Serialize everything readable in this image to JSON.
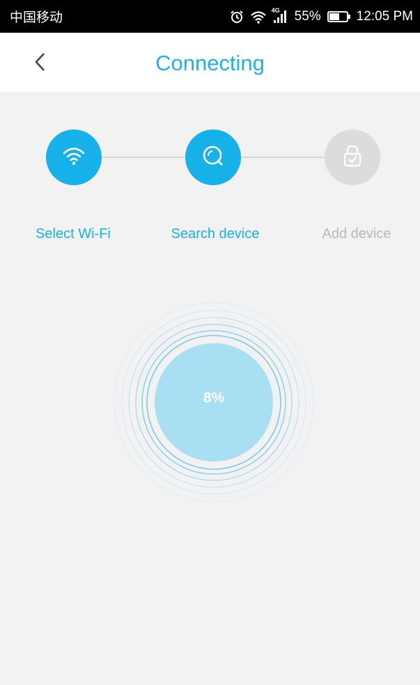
{
  "status_bar": {
    "carrier": "中国移动",
    "network": "4G",
    "battery": "55%",
    "time": "12:05 PM",
    "icons": [
      "alarm-icon",
      "wifi-icon",
      "signal-icon",
      "battery-icon"
    ]
  },
  "header": {
    "title": "Connecting",
    "back_icon": "chevron-left-icon"
  },
  "steps": [
    {
      "label": "Select Wi-Fi",
      "icon": "wifi-icon",
      "state": "complete"
    },
    {
      "label": "Search device",
      "icon": "search-icon",
      "state": "active"
    },
    {
      "label": "Add device",
      "icon": "lock-icon",
      "state": "pending"
    }
  ],
  "progress": {
    "value_text": "8%",
    "value": 0.08
  },
  "colors": {
    "accent": "#17b1ea",
    "inactive": "#dcdcdc",
    "progress_fill": "#a8dff2",
    "background": "#f2f2f2"
  }
}
